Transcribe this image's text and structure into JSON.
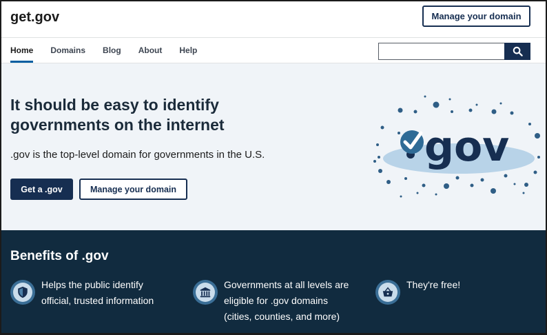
{
  "header": {
    "logo": "get.gov",
    "manage_button": "Manage your domain"
  },
  "nav": {
    "items": [
      {
        "label": "Home",
        "active": true
      },
      {
        "label": "Domains"
      },
      {
        "label": "Blog"
      },
      {
        "label": "About"
      },
      {
        "label": "Help"
      }
    ],
    "search": {
      "value": "",
      "icon": "search-icon"
    }
  },
  "hero": {
    "title": "It should be easy to identify governments on the internet",
    "subtitle": ".gov is the top-level domain for governments in the U.S.",
    "primary_button": "Get a .gov",
    "secondary_button": "Manage your domain",
    "graphic_text": "gov"
  },
  "benefits": {
    "title": "Benefits of .gov",
    "items": [
      {
        "text": "Helps the public identify\nofficial, trusted information",
        "icon": "shield-icon"
      },
      {
        "text": "Governments at all levels are\neligible for .gov domains\n(cities, counties, and more)",
        "icon": "government-building-icon"
      },
      {
        "text": "They're free!",
        "icon": "basket-icon"
      }
    ]
  },
  "colors": {
    "navy": "#162e51",
    "dark_band": "#112b3f",
    "hero_bg": "#f0f4f8",
    "accent_blue": "#005ea2"
  }
}
